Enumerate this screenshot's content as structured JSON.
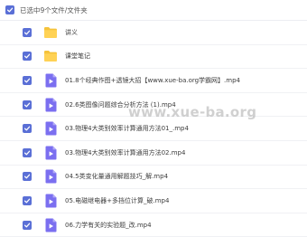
{
  "header": {
    "selection_text": "已选中9个文件/文件夹",
    "all_checked": true
  },
  "files": [
    {
      "name": "讲义",
      "type": "folder",
      "checked": true
    },
    {
      "name": "课堂笔记",
      "type": "folder",
      "checked": true
    },
    {
      "name": "01.8个经典作图+透镜大招【www.xue-ba.org学霸网】.mp4",
      "type": "video",
      "checked": true
    },
    {
      "name": "02.6类图像问题综合分析方法 (1).mp4",
      "type": "video",
      "checked": true
    },
    {
      "name": "03.物理4大类别效率计算通用方法01_.mp4",
      "type": "video",
      "checked": true
    },
    {
      "name": "03.物理4大类别效率计算通用方法02.mp4",
      "type": "video",
      "checked": true
    },
    {
      "name": "04.5类变化量通用解题技巧_解.mp4",
      "type": "video",
      "checked": true
    },
    {
      "name": "05.电磁继电器+多挡位计算_破.mp4",
      "type": "video",
      "checked": true
    },
    {
      "name": "06.力学有关的实验题_改.mp4",
      "type": "video",
      "checked": true
    }
  ],
  "watermark": "www.xue-ba.org",
  "colors": {
    "accent": "#5a6fd6",
    "folder": "#f5c33b",
    "video": "#7b6ff0"
  },
  "icons": {
    "folder": "folder-icon",
    "video": "video-file-icon",
    "check": "checkmark-icon"
  }
}
